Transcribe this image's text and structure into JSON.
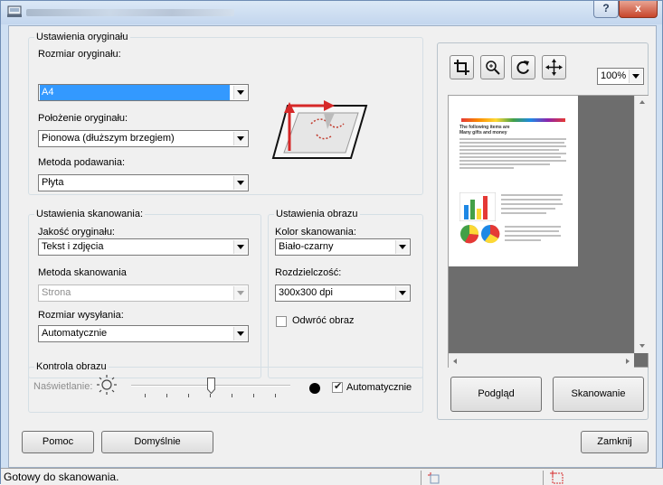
{
  "window": {
    "help_label": "?",
    "close_label": "x"
  },
  "original": {
    "legend": "Ustawienia oryginału",
    "size_label": "Rozmiar oryginału:",
    "size_value": "A4",
    "orientation_label": "Położenie oryginału:",
    "orientation_value": "Pionowa (dłuższym brzegiem)",
    "feed_label": "Metoda podawania:",
    "feed_value": "Płyta"
  },
  "scan": {
    "legend": "Ustawienia skanowania:",
    "quality_label": "Jakość oryginału:",
    "quality_value": "Tekst i zdjęcia",
    "method_label": "Metoda skanowania",
    "method_value": "Strona",
    "send_size_label": "Rozmiar wysyłania:",
    "send_size_value": "Automatycznie"
  },
  "image": {
    "legend": "Ustawienia obrazu",
    "color_label": "Kolor skanowania:",
    "color_value": "Biało-czarny",
    "resolution_label": "Rozdzielczość:",
    "resolution_value": "300x300 dpi",
    "invert_label": "Odwróć obraz",
    "invert_checked": false
  },
  "control": {
    "legend": "Kontrola obrazu",
    "exposure_label": "Naświetlanie:",
    "auto_label": "Automatycznie",
    "auto_checked": true,
    "exposure_level": 0.5
  },
  "preview": {
    "zoom_value": "100%",
    "doc_heading": "The following items are\nMany gifts and money",
    "tools": [
      "crop-icon",
      "zoom-icon",
      "rotate-icon",
      "move-icon"
    ],
    "preview_button": "Podgląd",
    "scan_button": "Skanowanie"
  },
  "footer": {
    "help_button": "Pomoc",
    "defaults_button": "Domyślnie",
    "close_button": "Zamknij"
  },
  "status": {
    "text": "Gotowy do skanowania."
  },
  "colors": {
    "selection": "#3399ff",
    "preview_bg": "#6d6d6d",
    "accent_red": "#d62828"
  }
}
